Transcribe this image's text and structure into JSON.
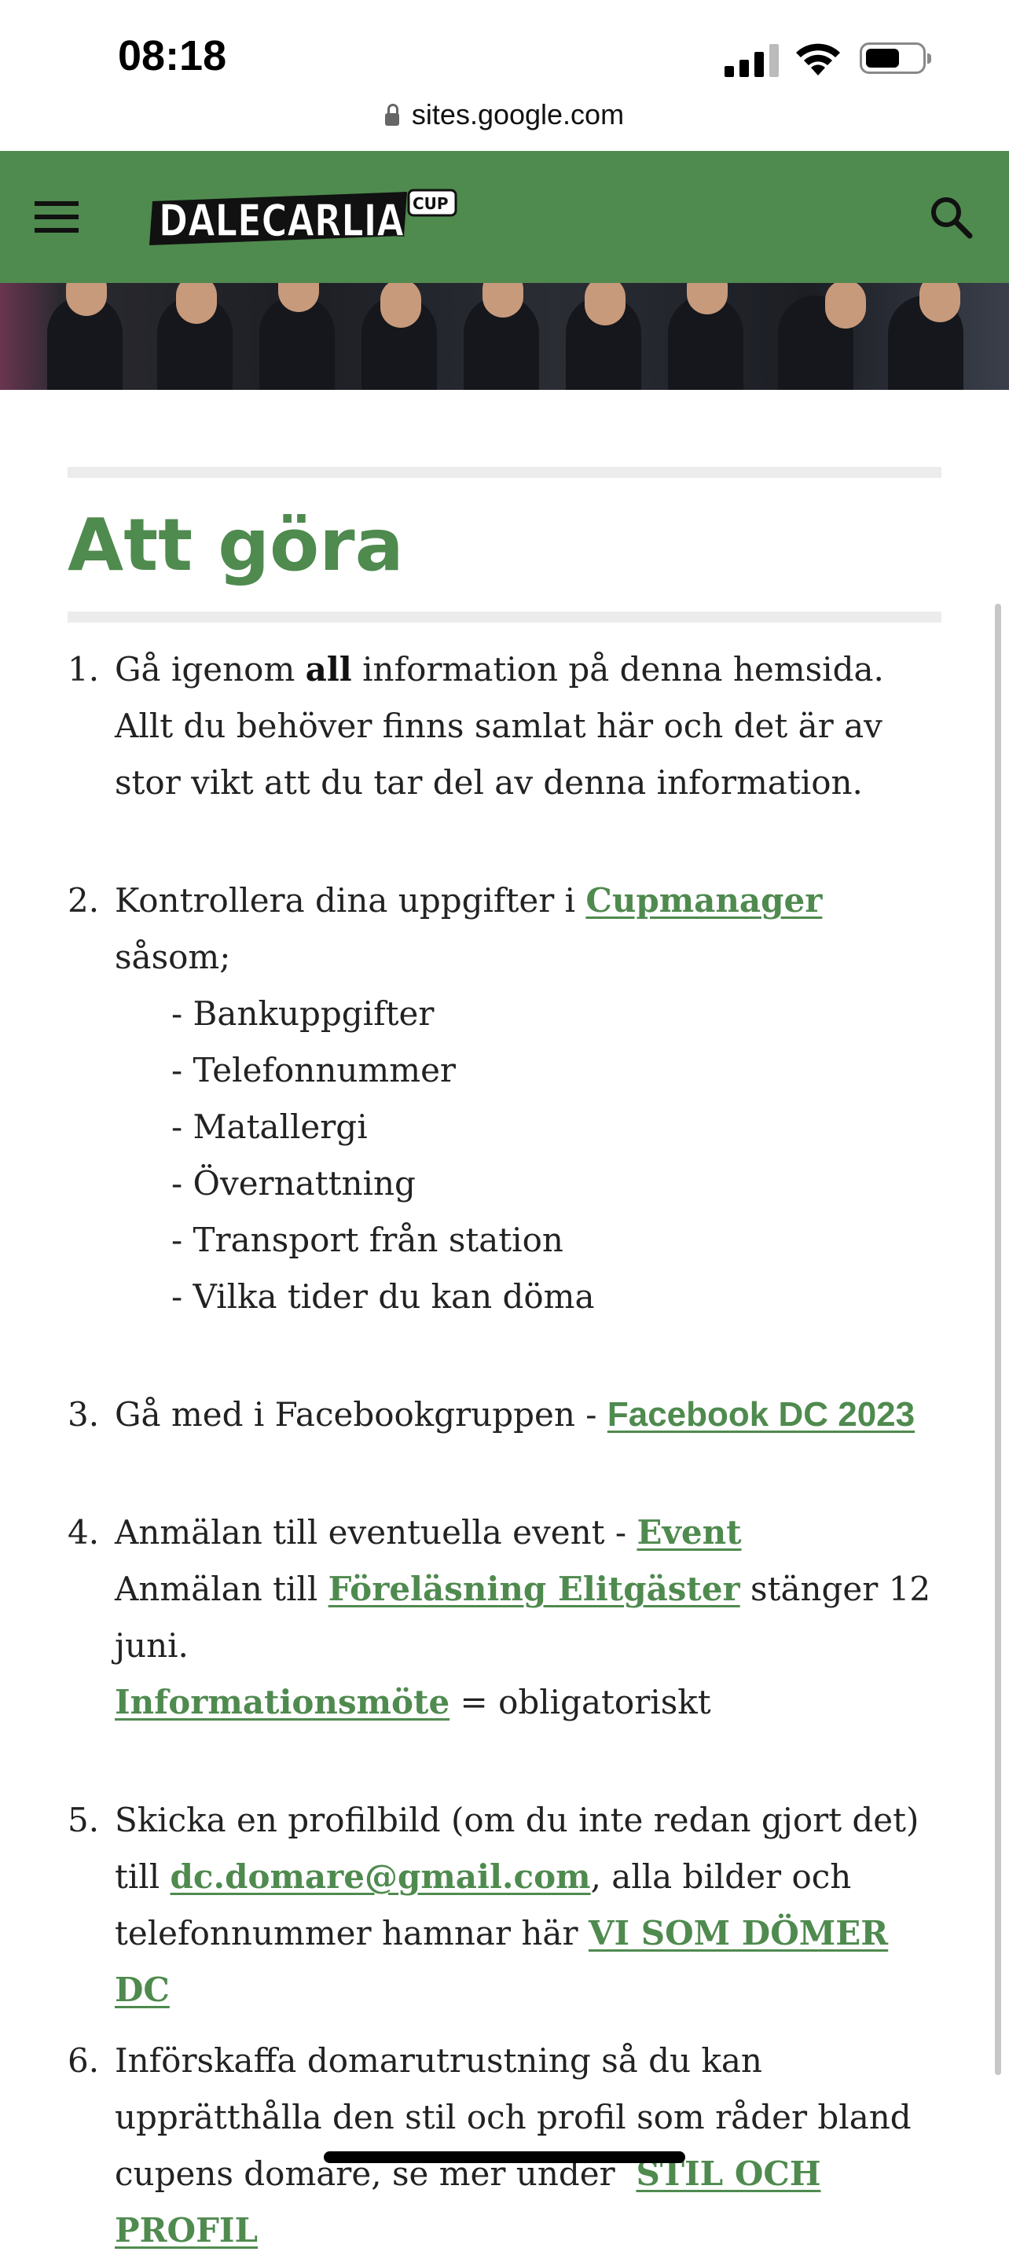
{
  "status_bar": {
    "time": "08:18",
    "url": "sites.google.com"
  },
  "header": {
    "logo_text": "DALECARLIA",
    "logo_cup": "CUP",
    "bg_color": "#4f8a4f"
  },
  "icons": {
    "menu": "hamburger-menu-icon",
    "search": "search-icon",
    "lock": "lock-icon"
  },
  "page": {
    "title": "Att göra",
    "items": [
      {
        "num": "1.",
        "pre": "Gå igenom ",
        "bold": "all",
        "post": " information på denna hemsida. Allt du behöver finns samlat här och det är av stor vikt att du tar del av denna information."
      },
      {
        "num": "2.",
        "pre": "Kontrollera dina uppgifter i ",
        "link": "Cupmanager ",
        "post": "såsom;",
        "subitems": [
          "- Bankuppgifter",
          "- Telefonnummer",
          "- Matallergi",
          "- Övernattning",
          "- Transport från station",
          "- Vilka tider du kan döma"
        ]
      },
      {
        "num": "3.",
        "pre": "Gå med i Facebookgruppen - ",
        "link": "Facebook DC 2023"
      },
      {
        "num": "4.",
        "line1_pre": "Anmälan till eventuella event - ",
        "line1_link": "Event",
        "line2_pre": "Anmälan till ",
        "line2_link": "Föreläsning Elitgäster",
        "line2_post": " stänger 12 juni.",
        "line3_link": "Informationsmöte",
        "line3_post": " = obligatoriskt"
      },
      {
        "num": "5.",
        "pre": "Skicka en profilbild (om du inte redan gjort det) till ",
        "link": "dc.domare@gmail.com",
        "mid": ", alla bilder och telefonnummer hamnar här ",
        "link2": "VI SOM DÖMER DC"
      },
      {
        "num": "6.",
        "pre": "Införskaffa domarutrustning så du kan upprätthålla den stil och profil som råder bland cupens domare, se mer under  ",
        "link": "STIL OCH PROFIL"
      }
    ]
  }
}
